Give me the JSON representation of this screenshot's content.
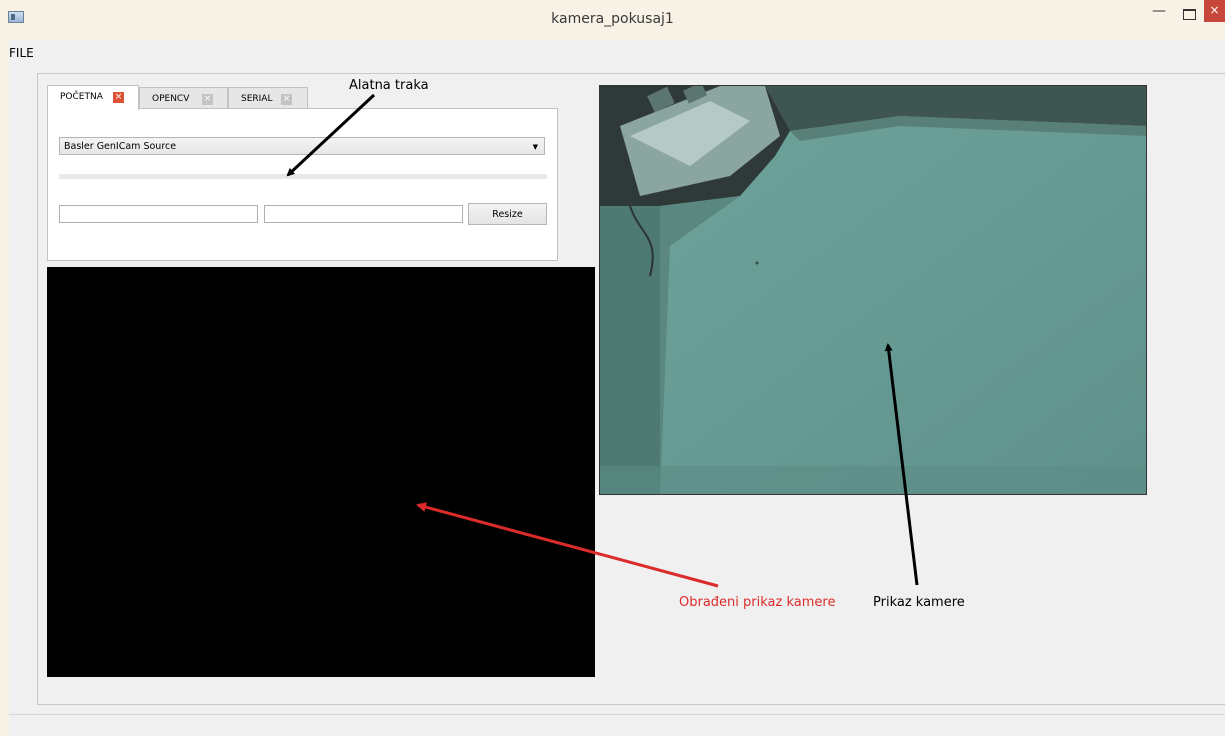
{
  "window": {
    "title": "kamera_pokusaj1"
  },
  "menubar": {
    "file_label": "FILE"
  },
  "tabs": [
    {
      "label": "POČETNA",
      "active": true
    },
    {
      "label": "OPENCV",
      "active": false
    },
    {
      "label": "SERIAL",
      "active": false
    }
  ],
  "pocetna": {
    "source_select_value": "Basler GenICam Source",
    "progress_percent": 0,
    "width_value": "",
    "height_value": "",
    "resize_label": "Resize"
  },
  "annotations": {
    "toolbar": "Alatna traka",
    "processed": "Obrađeni prikaz kamere",
    "camera": "Prikaz kamere"
  },
  "colors": {
    "annotation_red": "#dc2b2b",
    "annotation_black": "#000000",
    "close_button": "#c7483a"
  }
}
